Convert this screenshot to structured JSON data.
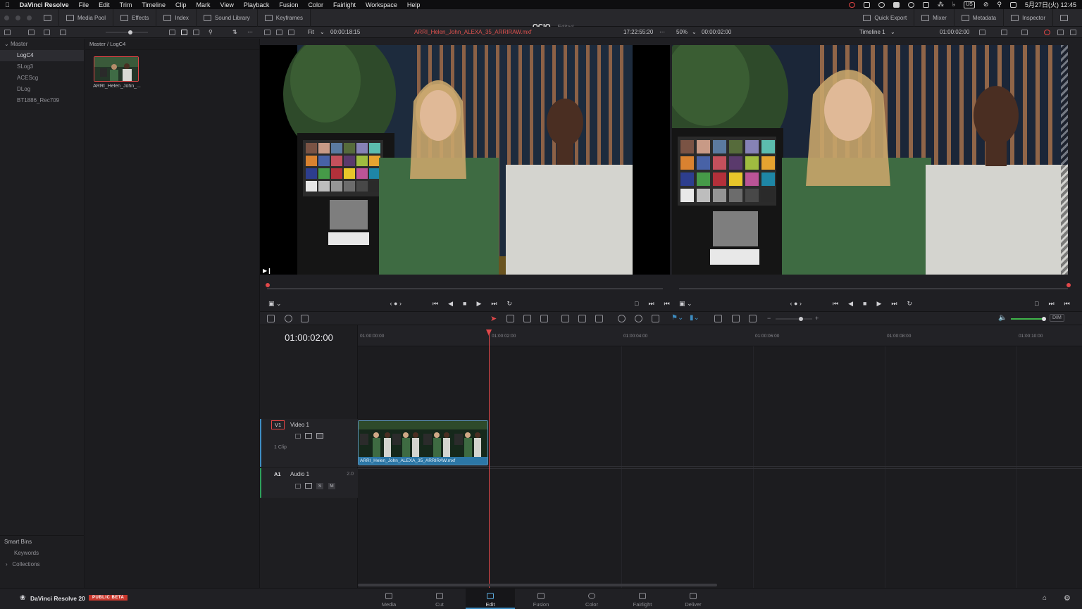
{
  "menubar": {
    "app": "DaVinci Resolve",
    "items": [
      "File",
      "Edit",
      "Trim",
      "Timeline",
      "Clip",
      "Mark",
      "View",
      "Playback",
      "Fusion",
      "Color",
      "Fairlight",
      "Workspace",
      "Help"
    ],
    "clock": "5月27日(火) 12:45",
    "input_source": "US"
  },
  "toolbar": {
    "left": [
      {
        "label": "Media Pool",
        "icon": "media-pool-icon"
      },
      {
        "label": "Effects",
        "icon": "effects-icon"
      },
      {
        "label": "Index",
        "icon": "index-icon"
      },
      {
        "label": "Sound Library",
        "icon": "sound-library-icon"
      },
      {
        "label": "Keyframes",
        "icon": "keyframes-icon"
      }
    ],
    "project_title": "OCIO",
    "project_status": "Edited",
    "right": [
      {
        "label": "Quick Export",
        "icon": "export-icon"
      },
      {
        "label": "Mixer",
        "icon": "mixer-icon"
      },
      {
        "label": "Metadata",
        "icon": "metadata-icon"
      },
      {
        "label": "Inspector",
        "icon": "inspector-icon"
      }
    ]
  },
  "viewer_bar": {
    "source_zoom": "Fit",
    "source_duration": "00:00:18:15",
    "source_clip": "ARRI_Helen_John_ALEXA_35_ARRIRAW.mxf",
    "source_timecode": "17:22:55:20",
    "timeline_zoom": "50%",
    "timeline_duration": "00:00:02:00",
    "timeline_name": "Timeline 1",
    "timeline_timecode": "01:00:02:00"
  },
  "bins": {
    "master": "Master",
    "items": [
      "LogC4",
      "SLog3",
      "ACEScg",
      "DLog",
      "BT1886_Rec709"
    ],
    "selected_index": 0,
    "smart_bins_title": "Smart Bins",
    "smart_bins": [
      "Keywords",
      "Collections"
    ]
  },
  "media_pool": {
    "path": "Master / LogC4",
    "clip_name": "ARRI_Helen_John_..."
  },
  "timeline": {
    "timecode": "01:00:02:00",
    "ruler": [
      "01:00:00:00",
      "01:00:02:00",
      "01:00:04:00",
      "01:00:06:00",
      "01:00:08:00",
      "01:00:10:00"
    ],
    "video_track": {
      "id": "V1",
      "name": "Video 1",
      "clips_count": "1 Clip"
    },
    "audio_track": {
      "id": "A1",
      "name": "Audio 1",
      "channels": "2.0",
      "solo": "S",
      "mute": "M"
    },
    "clip_name": "ARRI_Helen_John_ALEXA_35_ARRIRAW.mxf",
    "volume_label": "DIM"
  },
  "footer": {
    "product": "DaVinci Resolve 20",
    "badge": "PUBLIC BETA",
    "pages": [
      "Media",
      "Cut",
      "Edit",
      "Fusion",
      "Color",
      "Fairlight",
      "Deliver"
    ],
    "active_page": "Edit"
  },
  "colors": {
    "accent": "#3d8cc1",
    "playhead": "#e2484a",
    "clip_label": "#2c77a6",
    "badge": "#c8372d"
  }
}
